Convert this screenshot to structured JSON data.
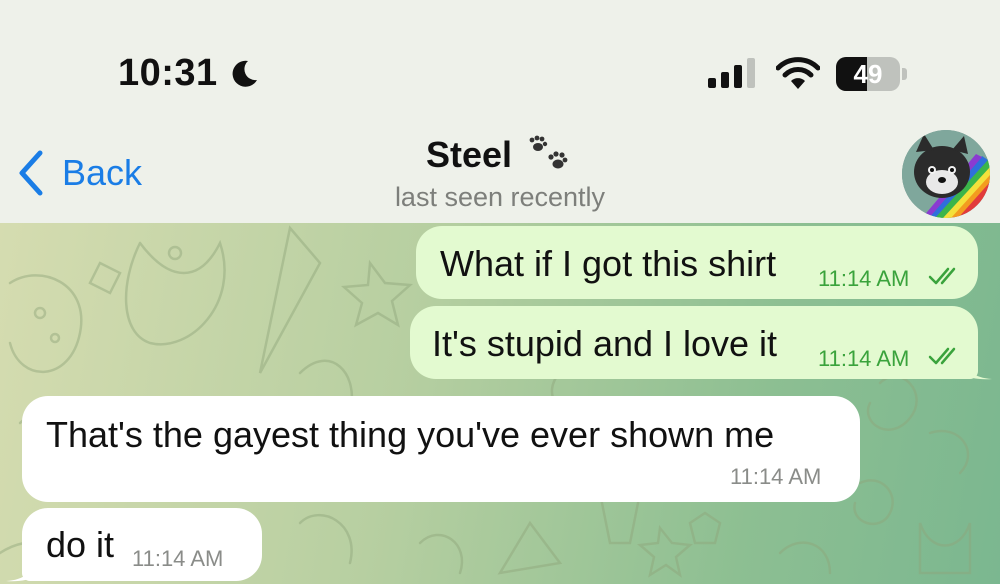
{
  "status_bar": {
    "time": "10:31",
    "battery": "49",
    "battery_level": 0.49
  },
  "header": {
    "back_label": "Back",
    "contact_name": "Steel",
    "contact_status": "last seen recently"
  },
  "messages": [
    {
      "direction": "out",
      "text": "What if I got this shirt",
      "time": "11:14 AM",
      "read": true
    },
    {
      "direction": "out",
      "text": "It's stupid and I love it",
      "time": "11:14 AM",
      "read": true
    },
    {
      "direction": "in",
      "text": "That's the gayest thing you've ever shown me",
      "time": "11:14 AM"
    },
    {
      "direction": "in",
      "text": "do it",
      "time": "11:14 AM"
    }
  ],
  "colors": {
    "accent": "#1a7de6",
    "outgoing_bubble": "#e3fad0",
    "incoming_bubble": "#ffffff",
    "outgoing_time": "#3aa33c",
    "header_bg": "#eef1ea"
  },
  "icons": [
    "moon-icon",
    "signal-icon",
    "wifi-icon",
    "battery-icon",
    "chevron-left-icon",
    "paw-prints-icon",
    "read-checkmarks-icon"
  ]
}
